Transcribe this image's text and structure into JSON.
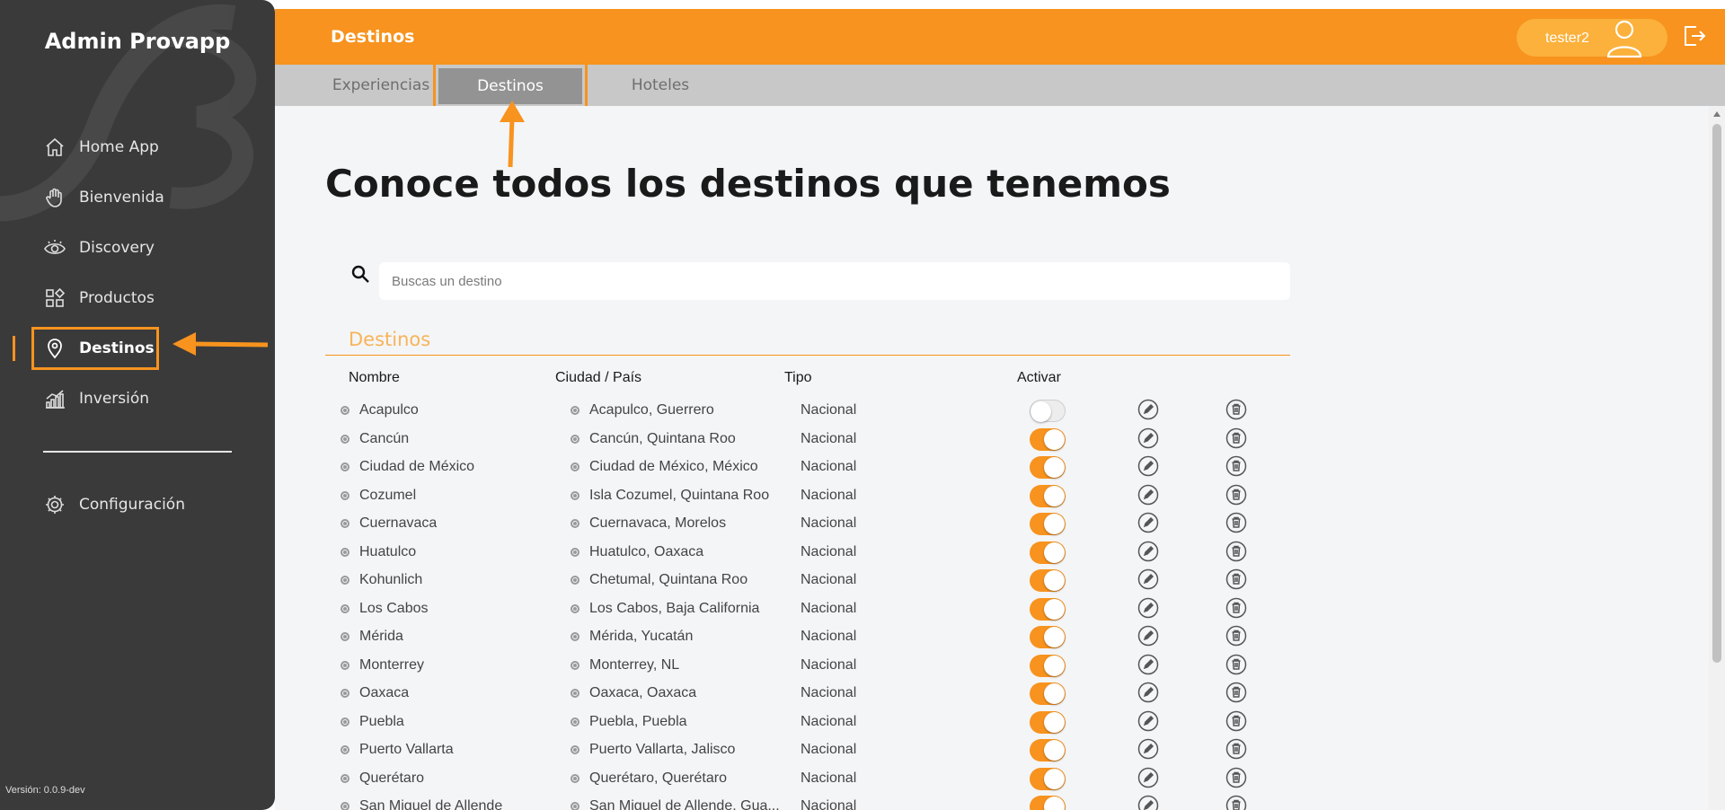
{
  "app": {
    "brand": "Admin Provapp",
    "version": "Versión: 0.0.9-dev"
  },
  "sidebar": {
    "items": [
      {
        "label": "Home App",
        "icon": "home-icon"
      },
      {
        "label": "Bienvenida",
        "icon": "wave-hand-icon"
      },
      {
        "label": "Discovery",
        "icon": "eye-icon"
      },
      {
        "label": "Productos",
        "icon": "grid-icon"
      },
      {
        "label": "Destinos",
        "icon": "location-pin-icon",
        "active": true
      },
      {
        "label": "Inversión",
        "icon": "bar-chart-icon"
      }
    ],
    "settings": {
      "label": "Configuración",
      "icon": "gear-icon"
    }
  },
  "header": {
    "title": "Destinos",
    "user": "tester2"
  },
  "tabs": [
    "Experiencias",
    "Destinos",
    "Hoteles"
  ],
  "active_tab": "Destinos",
  "main": {
    "title": "Conoce todos los destinos que tenemos",
    "search": {
      "placeholder": "Buscas un destino",
      "value": ""
    },
    "section_title": "Destinos",
    "columns": {
      "name": "Nombre",
      "location": "Ciudad / País",
      "type": "Tipo",
      "activate": "Activar"
    },
    "rows": [
      {
        "name": "Acapulco",
        "location": "Acapulco, Guerrero",
        "type": "Nacional",
        "active": false
      },
      {
        "name": "Cancún",
        "location": "Cancún, Quintana Roo",
        "type": "Nacional",
        "active": true
      },
      {
        "name": "Ciudad de México",
        "location": "Ciudad de México, México",
        "type": "Nacional",
        "active": true
      },
      {
        "name": "Cozumel",
        "location": "Isla Cozumel, Quintana Roo",
        "type": "Nacional",
        "active": true
      },
      {
        "name": "Cuernavaca",
        "location": "Cuernavaca, Morelos",
        "type": "Nacional",
        "active": true
      },
      {
        "name": "Huatulco",
        "location": "Huatulco, Oaxaca",
        "type": "Nacional",
        "active": true
      },
      {
        "name": "Kohunlich",
        "location": "Chetumal, Quintana Roo",
        "type": "Nacional",
        "active": true
      },
      {
        "name": "Los Cabos",
        "location": "Los Cabos, Baja California",
        "type": "Nacional",
        "active": true
      },
      {
        "name": "Mérida",
        "location": "Mérida, Yucatán",
        "type": "Nacional",
        "active": true
      },
      {
        "name": "Monterrey",
        "location": "Monterrey, NL",
        "type": "Nacional",
        "active": true
      },
      {
        "name": "Oaxaca",
        "location": "Oaxaca, Oaxaca",
        "type": "Nacional",
        "active": true
      },
      {
        "name": "Puebla",
        "location": "Puebla, Puebla",
        "type": "Nacional",
        "active": true
      },
      {
        "name": "Puerto Vallarta",
        "location": "Puerto Vallarta, Jalisco",
        "type": "Nacional",
        "active": true
      },
      {
        "name": "Querétaro",
        "location": "Querétaro, Querétaro",
        "type": "Nacional",
        "active": true
      },
      {
        "name": "San Miguel de Allende",
        "location": "San Miguel de Allende, Gua...",
        "type": "Nacional",
        "active": true
      }
    ]
  },
  "colors": {
    "accent": "#f7931e",
    "sidebar": "#3a3a3a",
    "tabs": "#c8c8c8",
    "active_tab": "#939393"
  }
}
